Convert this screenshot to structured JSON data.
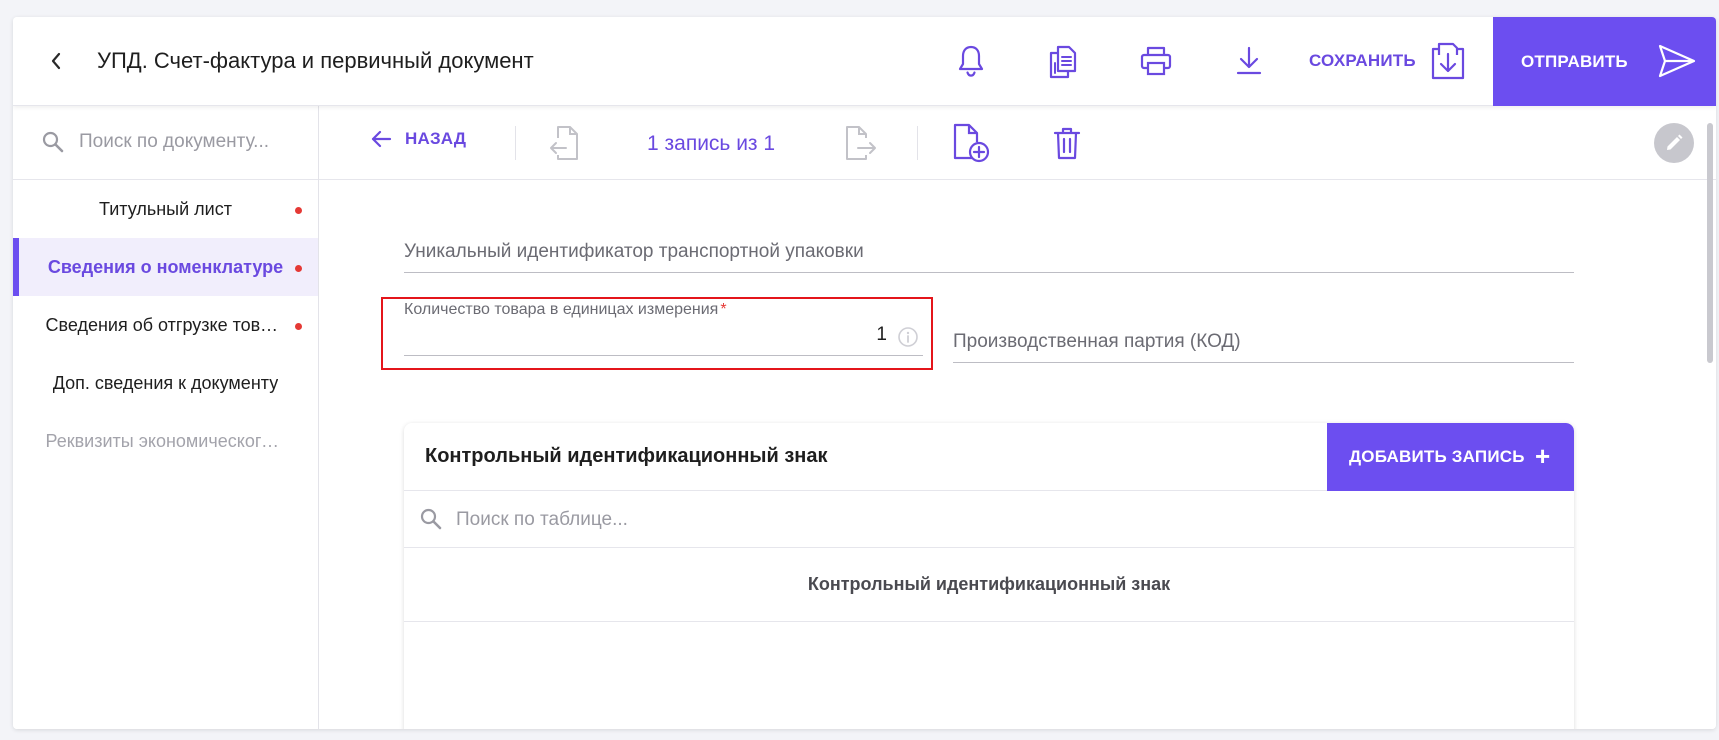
{
  "colors": {
    "accent": "#6c4ef0",
    "accent_text": "#6a49e0",
    "required": "#e53935",
    "highlight_border": "#e4151b"
  },
  "header": {
    "title": "УПД. Счет-фактура и первичный документ",
    "save_label": "СОХРАНИТЬ",
    "send_label": "ОТПРАВИТЬ",
    "icons": [
      "bell-icon",
      "copy-document-icon",
      "print-icon",
      "download-icon",
      "save-to-file-icon",
      "send-icon"
    ]
  },
  "sidebar": {
    "search_placeholder": "Поиск по документу...",
    "items": [
      {
        "label": "Титульный лист",
        "has_error": true,
        "state": "normal"
      },
      {
        "label": "Сведения о номенклатуре",
        "has_error": true,
        "state": "active"
      },
      {
        "label": "Сведения об отгрузке товаров",
        "has_error": true,
        "state": "normal"
      },
      {
        "label": "Доп. сведения к документу",
        "has_error": false,
        "state": "normal"
      },
      {
        "label": "Реквизиты экономического субъекта",
        "has_error": false,
        "state": "disabled"
      }
    ]
  },
  "toolbar": {
    "back_label": "НАЗАД",
    "record_counter": "1 запись из 1",
    "icons": [
      "previous-record-icon",
      "next-record-icon",
      "add-record-icon",
      "delete-icon",
      "edit-icon"
    ]
  },
  "form": {
    "transport_package_id": {
      "placeholder": "Уникальный идентификатор транспортной упаковки",
      "value": ""
    },
    "quantity": {
      "label": "Количество товара в единицах измерения",
      "required_mark": "*",
      "value": "1"
    },
    "batch_code": {
      "placeholder": "Производственная партия (КОД)",
      "value": ""
    }
  },
  "table": {
    "title": "Контрольный идентификационный знак",
    "add_label": "ДОБАВИТЬ ЗАПИСЬ",
    "add_icon": "+",
    "search_placeholder": "Поиск по таблице...",
    "columns": [
      "Контрольный идентификационный знак"
    ],
    "rows": []
  }
}
